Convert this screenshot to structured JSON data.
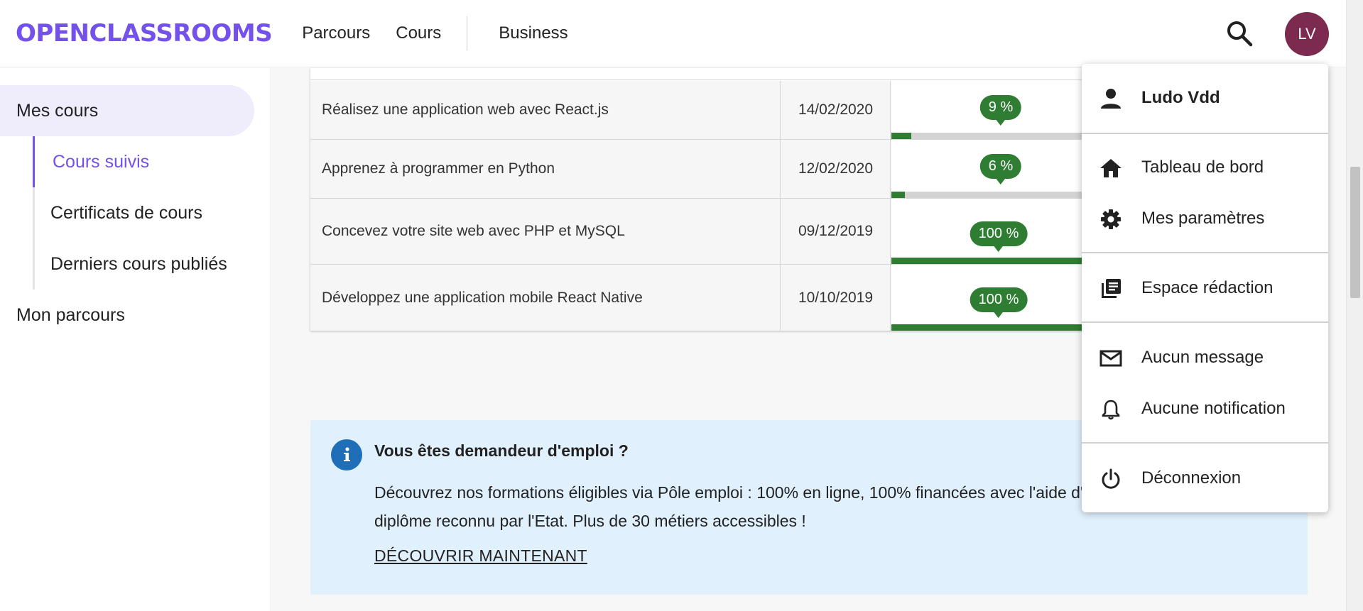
{
  "header": {
    "logo": "OPENCLASSROOMS",
    "nav": [
      "Parcours",
      "Cours",
      "Business"
    ],
    "avatar_initials": "LV",
    "avatar_color": "#7c2a4f",
    "brand_color": "#7451eb"
  },
  "sidebar": {
    "main_items": [
      {
        "label": "Mes cours",
        "active": true
      },
      {
        "label": "Mon parcours",
        "active": false
      }
    ],
    "sub_items": [
      {
        "label": "Cours suivis",
        "active": true
      },
      {
        "label": "Certificats de cours",
        "active": false
      },
      {
        "label": "Derniers cours publiés",
        "active": false
      }
    ]
  },
  "courses": {
    "rows": [
      {
        "title": "Réalisez une application web avec React.js",
        "date": "14/02/2020",
        "progress_label": "9 %",
        "progress": 9
      },
      {
        "title": "Apprenez à programmer en Python",
        "date": "12/02/2020",
        "progress_label": "6 %",
        "progress": 6
      },
      {
        "title": "Concevez votre site web avec PHP et MySQL",
        "date": "09/12/2019",
        "progress_label": "100 %",
        "progress": 100
      },
      {
        "title": "Développez une application mobile React Native",
        "date": "10/10/2019",
        "progress_label": "100 %",
        "progress": 100
      }
    ],
    "progress_color": "#2e7d32"
  },
  "info_box": {
    "title": "Vous êtes demandeur d'emploi ?",
    "text": "Découvrez nos formations éligibles via Pôle emploi : 100% en ligne, 100% financées avec l'aide d'un mentor, et obtenez un diplôme reconnu par l'Etat. Plus de 30 métiers accessibles !",
    "link": "DÉCOUVRIR MAINTENANT"
  },
  "user_menu": {
    "user_name": "Ludo Vdd",
    "items": [
      {
        "label": "Tableau de bord",
        "icon": "home-icon"
      },
      {
        "label": "Mes paramètres",
        "icon": "gear-icon"
      },
      {
        "label": "Espace rédaction",
        "icon": "library-books-icon"
      },
      {
        "label": "Aucun message",
        "icon": "mail-icon"
      },
      {
        "label": "Aucune notification",
        "icon": "bell-icon"
      },
      {
        "label": "Déconnexion",
        "icon": "power-icon"
      }
    ]
  }
}
